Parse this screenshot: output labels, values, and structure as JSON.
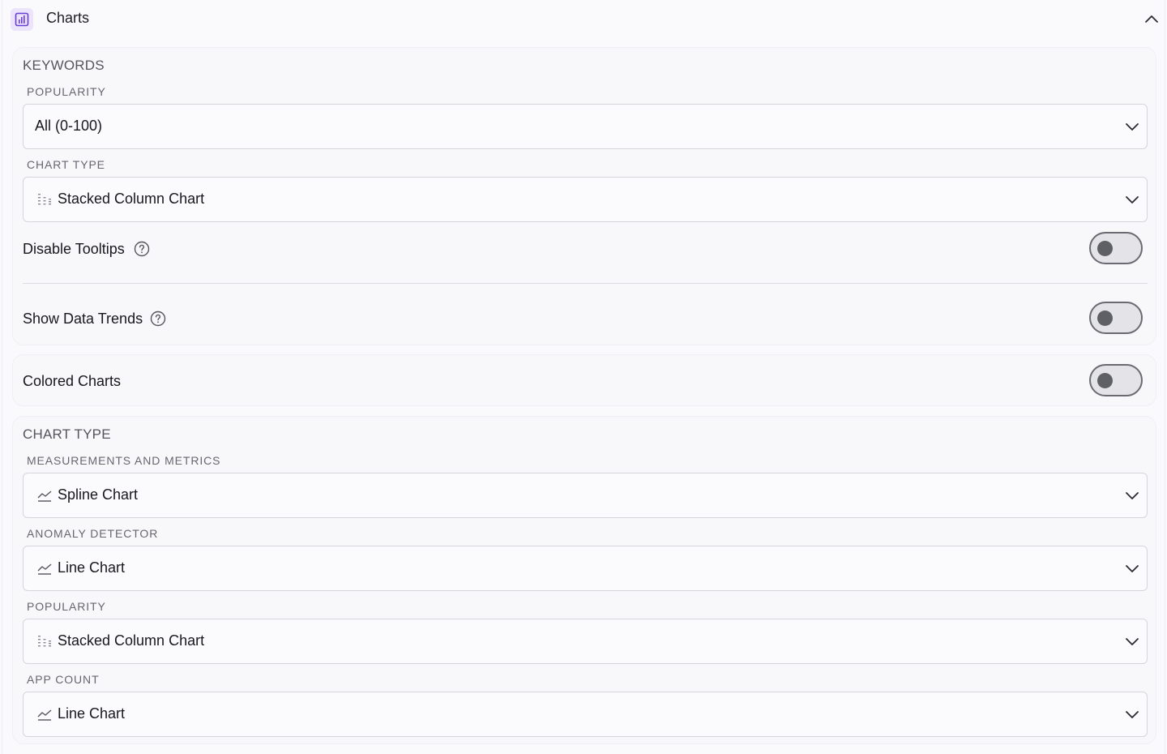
{
  "header": {
    "title": "Charts",
    "icon": "bar-chart-icon",
    "collapse_icon": "chevron-up-icon",
    "accent": "#6b3fd6"
  },
  "keywords": {
    "title": "KEYWORDS",
    "popularity_label": "POPULARITY",
    "popularity_value": "All (0-100)",
    "chart_type_label": "CHART TYPE",
    "chart_type_value": "Stacked Column Chart",
    "disable_tooltips_label": "Disable Tooltips",
    "show_data_trends_label": "Show Data Trends"
  },
  "colored": {
    "label": "Colored Charts"
  },
  "chart_type": {
    "title": "CHART TYPE",
    "fields": [
      {
        "label": "MEASUREMENTS AND METRICS",
        "value": "Spline Chart",
        "icon": "line-chart-icon"
      },
      {
        "label": "ANOMALY DETECTOR",
        "value": "Line Chart",
        "icon": "line-chart-icon"
      },
      {
        "label": "POPULARITY",
        "value": "Stacked Column Chart",
        "icon": "stacked-column-icon"
      },
      {
        "label": "APP COUNT",
        "value": "Line Chart",
        "icon": "line-chart-icon"
      }
    ]
  },
  "toggles": {
    "disable_tooltips": false,
    "show_data_trends": false,
    "colored_charts": false
  }
}
